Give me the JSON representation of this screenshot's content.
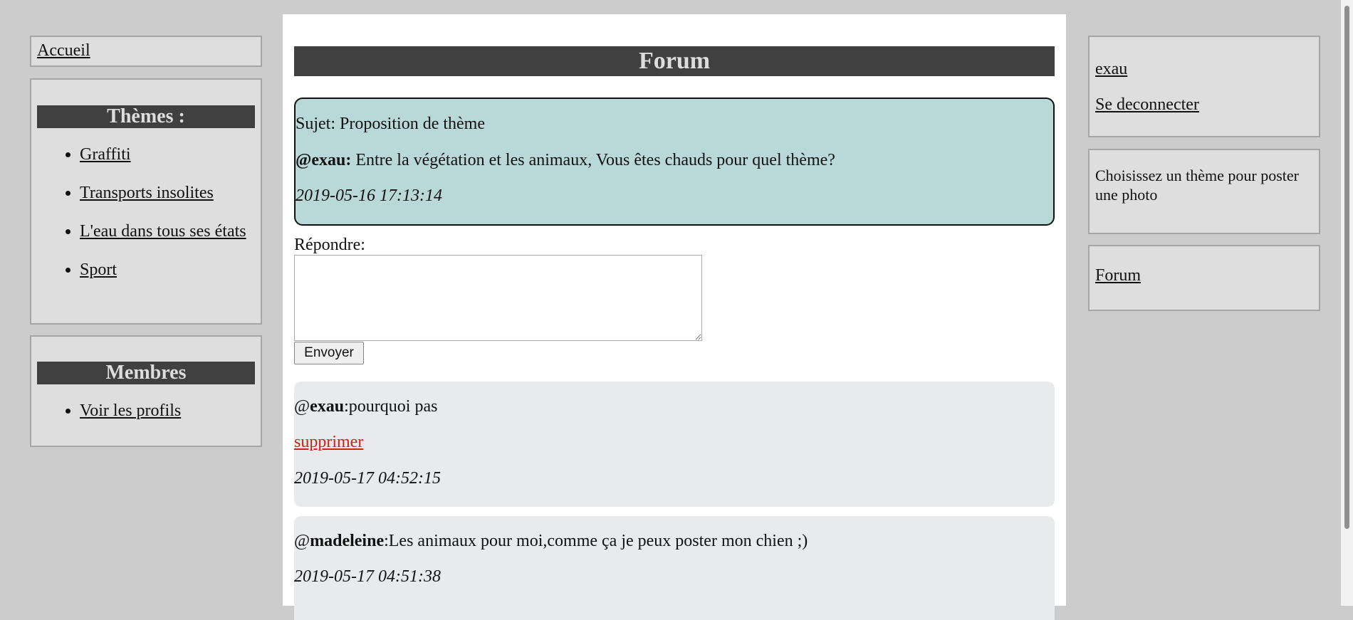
{
  "left": {
    "home_link": "Accueil",
    "themes": {
      "title": "Thèmes :",
      "items": [
        "Graffiti",
        "Transports insolites",
        "L'eau dans tous ses états",
        "Sport"
      ]
    },
    "members": {
      "title": "Membres",
      "items": [
        "Voir les profils"
      ]
    }
  },
  "main": {
    "title": "Forum",
    "subject": {
      "label": "Sujet: Proposition de thème",
      "author": "@exau:",
      "message": " Entre la végétation et les animaux, Vous êtes chauds pour quel thème?",
      "date": "2019-05-16 17:13:14"
    },
    "reply": {
      "label": "Répondre:",
      "textarea_value": "",
      "send_label": "Envoyer"
    },
    "posts": [
      {
        "at": "@",
        "author": "exau",
        "message": ":pourquoi pas",
        "delete_label": "supprimer",
        "date": "2019-05-17 04:52:15"
      },
      {
        "at": "@",
        "author": "madeleine",
        "message": ":Les animaux pour moi,comme ça je peux poster mon chien ;)",
        "date": "2019-05-17 04:51:38"
      }
    ]
  },
  "right": {
    "username": "exau",
    "logout_label": "Se deconnecter",
    "info_text": "Choisissez un thème pour poster une photo",
    "forum_link": "Forum"
  },
  "colors": {
    "page_background": "#cccccc",
    "box_background": "#dedede",
    "title_bar": "#404040",
    "subject_background": "#b9d8d8",
    "post_background": "#e8eaeb",
    "delete_link": "#d41e1e"
  }
}
